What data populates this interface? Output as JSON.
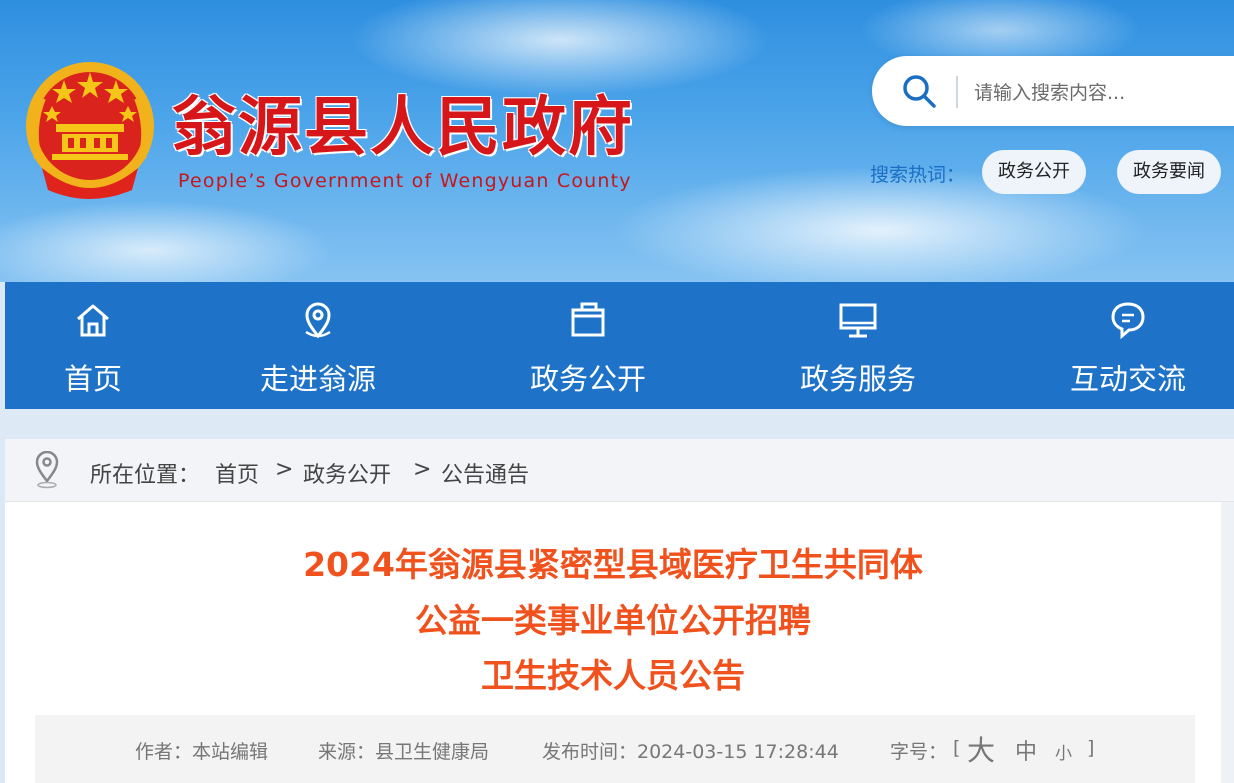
{
  "header": {
    "title": "翁源县人民政府",
    "subtitle": "People’s Government of Wengyuan County",
    "emblem_icon": "national-emblem-icon"
  },
  "search": {
    "placeholder": "请输入搜索内容...",
    "icon": "search-icon",
    "hot_label": "搜索热词：",
    "hot_tags": [
      "政务公开",
      "政务要闻"
    ]
  },
  "nav": {
    "items": [
      {
        "label": "首页",
        "icon": "home-icon"
      },
      {
        "label": "走进翁源",
        "icon": "location-pin-icon"
      },
      {
        "label": "政务公开",
        "icon": "folder-icon"
      },
      {
        "label": "政务服务",
        "icon": "monitor-icon"
      },
      {
        "label": "互动交流",
        "icon": "chat-bubble-icon"
      }
    ]
  },
  "breadcrumb": {
    "prefix": "所在位置：",
    "items": [
      "首页",
      "政务公开",
      "公告通告"
    ],
    "separator": ">"
  },
  "article": {
    "title_lines": [
      "2024年翁源县紧密型县域医疗卫生共同体",
      "公益一类事业单位公开招聘",
      "卫生技术人员公告"
    ],
    "meta": {
      "author": "作者：本站编辑",
      "source": "来源：县卫生健康局",
      "published": "发布时间：2024-03-15 17:28:44",
      "font_size_label": "字号：",
      "bracket_open": "[",
      "bracket_close": "]",
      "font_sizes": [
        "大",
        "中",
        "小"
      ]
    }
  },
  "colors": {
    "brand_red": "#d7161a",
    "nav_blue": "#1e72c8",
    "title_orange": "#f1521d",
    "link_blue": "#1a6fc4"
  }
}
